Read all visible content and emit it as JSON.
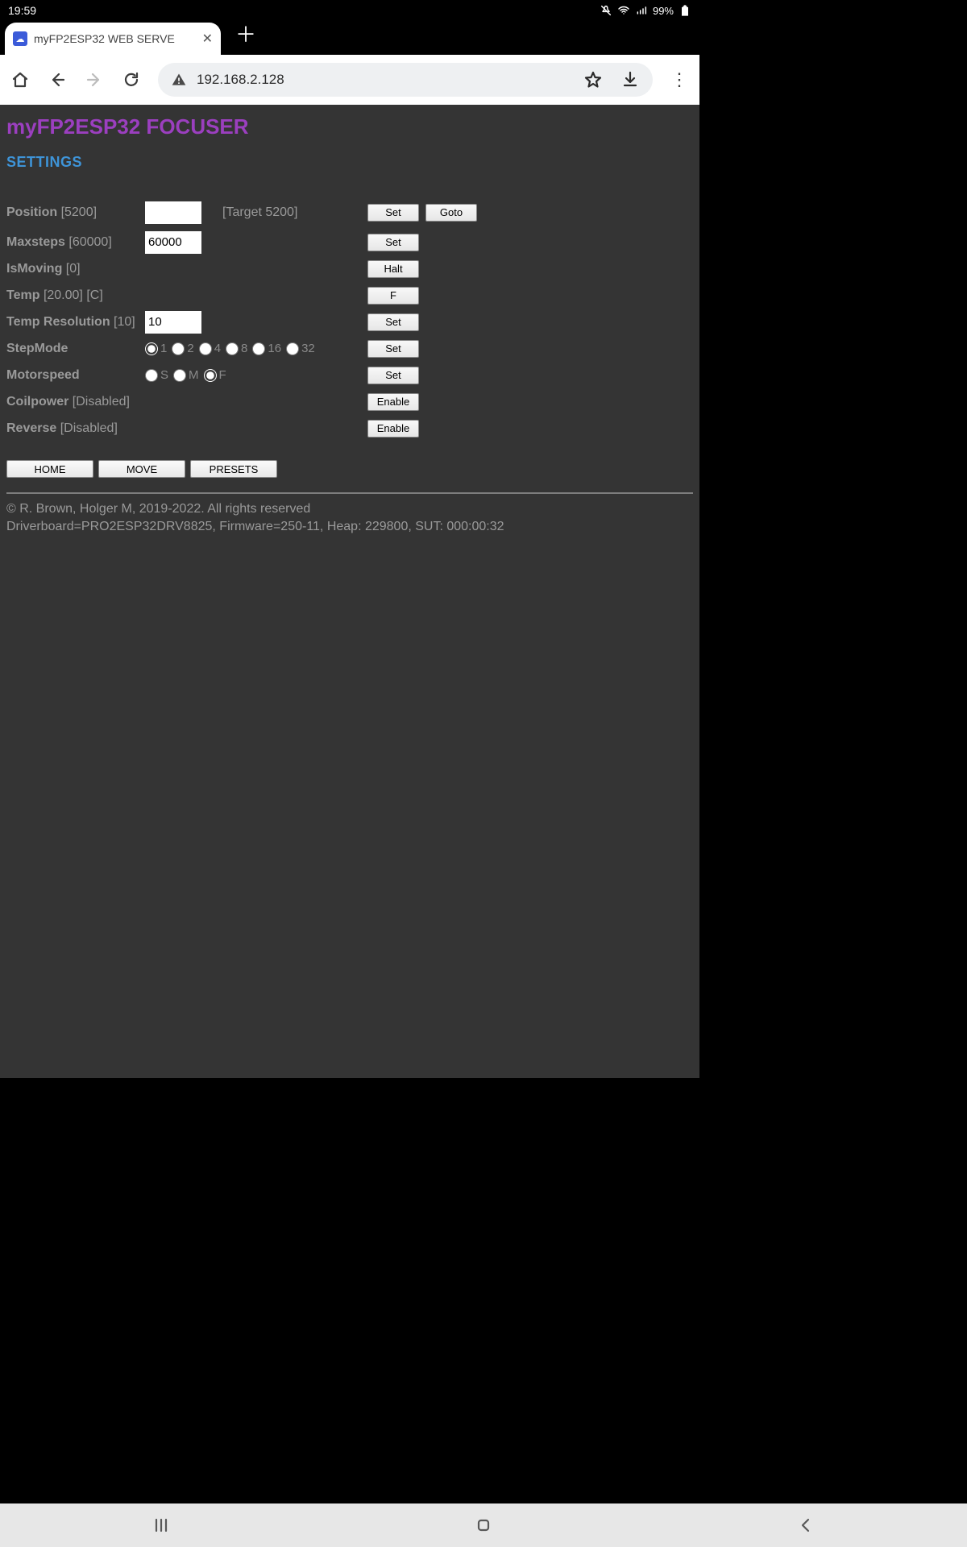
{
  "status": {
    "time": "19:59",
    "battery_pct": "99%"
  },
  "browser": {
    "tab_title": "myFP2ESP32 WEB SERVE",
    "url": "192.168.2.128"
  },
  "page": {
    "title": "myFP2ESP32 FOCUSER",
    "subtitle": "SETTINGS",
    "position": {
      "label": "Position",
      "value": "[5200]",
      "target": "[Target 5200]",
      "set": "Set",
      "goto": "Goto"
    },
    "maxsteps": {
      "label": "Maxsteps",
      "value": "[60000]",
      "input": "60000",
      "set": "Set"
    },
    "ismoving": {
      "label": "IsMoving",
      "value": "[0]",
      "halt": "Halt"
    },
    "temp": {
      "label": "Temp",
      "value": "[20.00] [C]",
      "unit": "F"
    },
    "tempres": {
      "label": "Temp Resolution",
      "value": "[10]",
      "input": "10",
      "set": "Set"
    },
    "stepmode": {
      "label": "StepMode",
      "options": [
        "1",
        "2",
        "4",
        "8",
        "16",
        "32"
      ],
      "selected": "1",
      "set": "Set"
    },
    "motorspeed": {
      "label": "Motorspeed",
      "options": [
        "S",
        "M",
        "F"
      ],
      "selected": "F",
      "set": "Set"
    },
    "coilpower": {
      "label": "Coilpower",
      "value": "[Disabled]",
      "enable": "Enable"
    },
    "reverse": {
      "label": "Reverse",
      "value": "[Disabled]",
      "enable": "Enable"
    },
    "nav": {
      "home": "HOME",
      "move": "MOVE",
      "presets": "PRESETS"
    },
    "footer_line1": "© R. Brown, Holger M, 2019-2022. All rights reserved",
    "footer_line2": "Driverboard=PRO2ESP32DRV8825, Firmware=250-11, Heap: 229800, SUT: 000:00:32"
  }
}
